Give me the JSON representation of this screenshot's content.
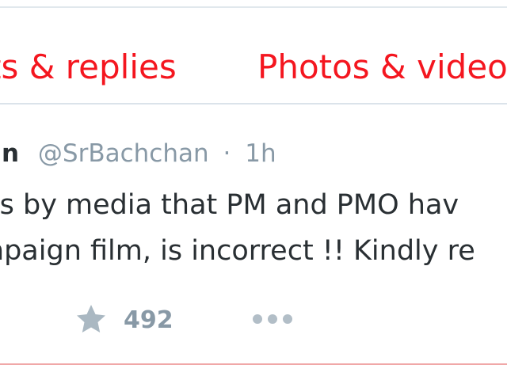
{
  "tabs": {
    "items": [
      {
        "label": "ts & replies"
      },
      {
        "label": "Photos & video"
      }
    ]
  },
  "tweet": {
    "name": "han",
    "handle": "@SrBachchan",
    "separator": "·",
    "time": "1h",
    "text_lines": [
      "ws by media that PM and PMO hav",
      "mpaign film, is incorrect !! Kindly re"
    ],
    "actions": {
      "favorite_count": "492",
      "favorite_icon": "star-icon",
      "more_icon": "more-icon"
    }
  },
  "colors": {
    "accent": "#f4161f",
    "muted": "#8899a6",
    "text": "#292f33",
    "divider": "#dbe3ea",
    "bottom_divider": "#f0a8a8"
  }
}
